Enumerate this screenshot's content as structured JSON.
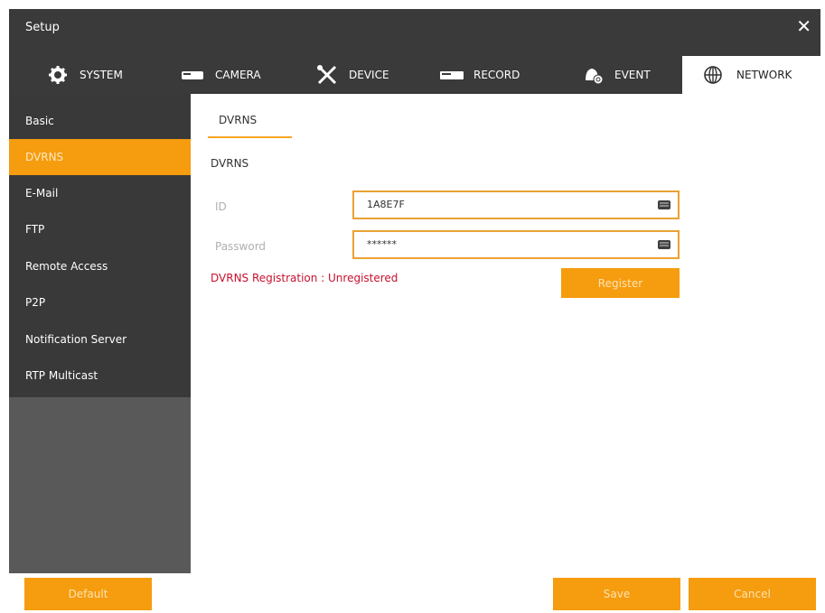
{
  "window": {
    "title": "Setup",
    "close_icon": "close-icon"
  },
  "tabs": [
    {
      "label": "SYSTEM",
      "icon": "gear-icon"
    },
    {
      "label": "CAMERA",
      "icon": "camera-icon"
    },
    {
      "label": "DEVICE",
      "icon": "tools-icon"
    },
    {
      "label": "RECORD",
      "icon": "record-icon"
    },
    {
      "label": "EVENT",
      "icon": "bell-icon"
    },
    {
      "label": "NETWORK",
      "icon": "globe-icon"
    }
  ],
  "active_tab": "NETWORK",
  "sidebar": {
    "items": [
      {
        "label": "Basic"
      },
      {
        "label": "DVRNS"
      },
      {
        "label": "E-Mail"
      },
      {
        "label": "FTP"
      },
      {
        "label": "Remote Access"
      },
      {
        "label": "P2P"
      },
      {
        "label": "Notification Server"
      },
      {
        "label": "RTP Multicast"
      }
    ],
    "active": "DVRNS"
  },
  "content": {
    "subtab": "DVRNS",
    "section_label": "DVRNS",
    "id_label": "ID",
    "id_value": "1A8E7F",
    "password_label": "Password",
    "password_value": "******",
    "registration_status": "DVRNS Registration : Unregistered",
    "register_button": "Register"
  },
  "footer": {
    "default_button": "Default",
    "save_button": "Save",
    "cancel_button": "Cancel"
  },
  "colors": {
    "accent": "#f59c0f",
    "titlebar": "#3a3a3a",
    "sidebar": "#393939",
    "status_text": "#c8102e"
  }
}
